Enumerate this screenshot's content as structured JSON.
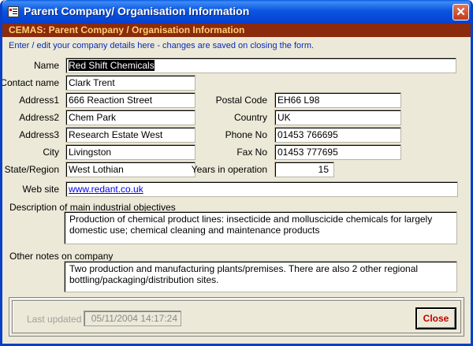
{
  "window": {
    "title": "Parent Company/ Organisation Information",
    "title_bar_color": "#0a55e0",
    "close_icon": "close-icon"
  },
  "header": {
    "band_text": "CEMAS: Parent Company / Organisation Information",
    "band_color": "#8b2a0d",
    "band_text_color": "#ffd070"
  },
  "instructions": "Enter / edit your company details here - changes are saved on closing the form.",
  "fields": {
    "name": {
      "label": "Name",
      "value": "Red Shift Chemicals"
    },
    "contact_name": {
      "label": "Contact name",
      "value": "Clark Trent"
    },
    "address1": {
      "label": "Address1",
      "value": "666 Reaction Street"
    },
    "address2": {
      "label": "Address2",
      "value": "Chem Park"
    },
    "address3": {
      "label": "Address3",
      "value": "Research Estate West"
    },
    "city": {
      "label": "City",
      "value": "Livingston"
    },
    "state_region": {
      "label": "State/Region",
      "value": "West Lothian"
    },
    "postal_code": {
      "label": "Postal Code",
      "value": "EH66 L98"
    },
    "country": {
      "label": "Country",
      "value": "UK"
    },
    "phone_no": {
      "label": "Phone No",
      "value": "01453 766695"
    },
    "fax_no": {
      "label": "Fax No",
      "value": "01453 777695"
    },
    "years_in_operation": {
      "label": "Years in operation",
      "value": "15"
    },
    "web_site": {
      "label": "Web site",
      "value": "www.redant.co.uk"
    }
  },
  "description": {
    "label": "Description of main industrial objectives",
    "value": "Production of chemical product lines: insecticide and molluscicide chemicals for largely domestic use; chemical cleaning and maintenance products"
  },
  "other_notes": {
    "label": "Other notes on company",
    "value": "Two production and manufacturing plants/premises. There are also 2 other  regional bottling/packaging/distribution sites."
  },
  "footer": {
    "last_updated_label": "Last updated",
    "last_updated_value": "05/11/2004 14:17:24",
    "close_label": "Close"
  }
}
